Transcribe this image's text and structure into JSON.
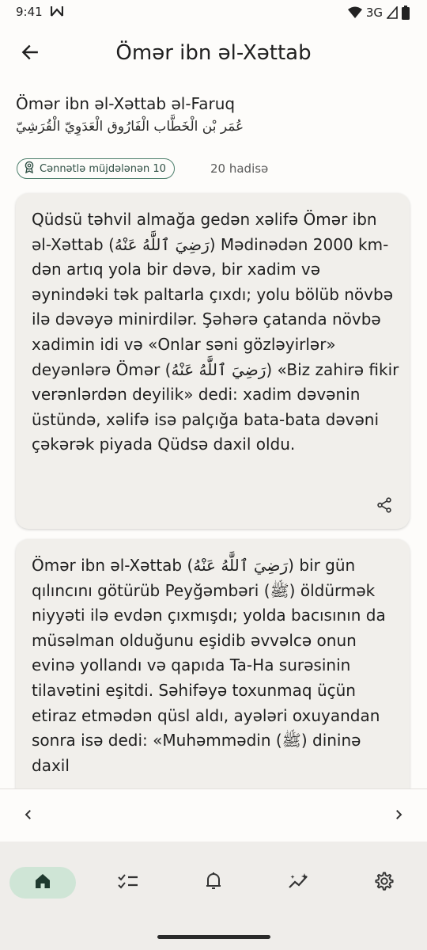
{
  "status_bar": {
    "time": "9:41",
    "network": "3G"
  },
  "header": {
    "title": "Ömər ibn əl-Xəttab",
    "back_icon": "arrow-left-icon"
  },
  "person": {
    "full_name": "Ömər ibn əl-Xəttab əl-Faruq",
    "arabic_name": "عُمَر بْن الْخَطَّاب الْفَارُوق الْعَدَوِيّ الْقُرَشِيّ",
    "chip_label": "Cənnətlə müjdələnən 10",
    "chip_icon": "award-medal-icon",
    "hadith_count": "20 hadisə"
  },
  "cards": [
    {
      "text": "Qüdsü təhvil almağa gedən xəlifə Ömər ibn əl-Xəttab (رَضِيَ ٱللَّٰهُ عَنْهُ) Mədinədən 2000 km-dən artıq yola bir dəvə, bir xadim və əynindəki tək paltarla çıxdı; yolu bölüb növbə ilə dəvəyə minirdilər. Şəhərə çatanda növbə xadimin idi və «Onlar səni gözləyirlər» deyənlərə Ömər (رَضِيَ ٱللَّٰهُ عَنْهُ) «Biz zahirə fikir verənlərdən deyilik» dedi: xadim dəvənin üstündə, xəlifə isə palçığa bata-bata dəvəni çəkərək piyada Qüdsə daxil oldu.",
      "share_icon": "share-icon"
    },
    {
      "text": "Ömər ibn əl-Xəttab (رَضِيَ ٱللَّٰهُ عَنْهُ) bir gün qılıncını götürüb Peyğəmbəri (ﷺ) öldürmək niyyəti ilə evdən çıxmışdı; yolda bacısının da müsəlman olduğunu eşidib əvvəlcə onun evinə yollandı və qapıda Ta-Ha surəsinin tilavətini eşitdi. Səhifəyə toxunmaq üçün etiraz etmədən qüsl aldı, ayələri oxuyandan sonra isə dedi: «Muhəmmədin (ﷺ) dininə daxil"
    }
  ],
  "pager": {
    "prev_icon": "chevron-left-icon",
    "next_icon": "chevron-right-icon"
  },
  "bottom_nav": {
    "items": [
      {
        "icon": "home-icon",
        "active": true
      },
      {
        "icon": "checklist-icon",
        "active": false
      },
      {
        "icon": "bell-icon",
        "active": false
      },
      {
        "icon": "sparkle-trend-icon",
        "active": false
      },
      {
        "icon": "gear-icon",
        "active": false
      }
    ]
  },
  "colors": {
    "accent": "#4d7f6c",
    "nav_active_bg": "#cfe5d6",
    "card_bg": "#f1efeb",
    "page_bg": "#fdfcfa"
  }
}
